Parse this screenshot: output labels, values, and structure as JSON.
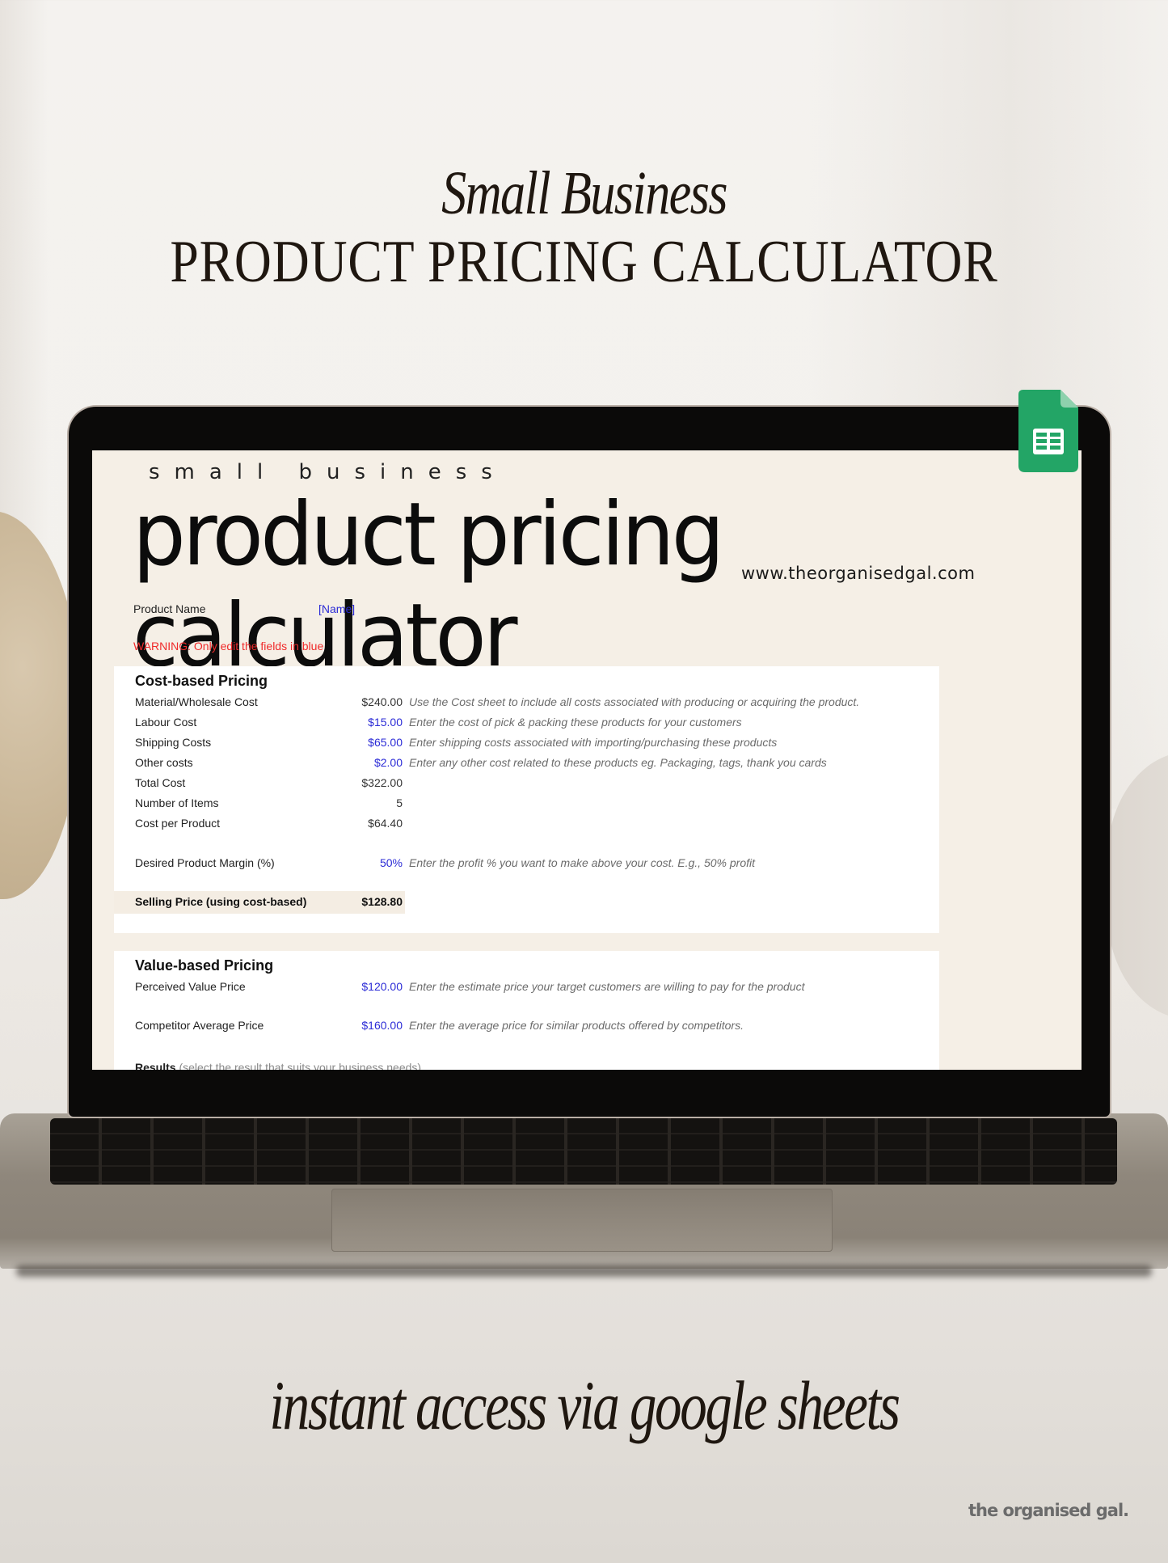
{
  "promo": {
    "headline_sub": "Small Business",
    "headline_main": "PRODUCT PRICING CALCULATOR",
    "tagline": "instant access via google sheets",
    "brand_logo": "the organised gal."
  },
  "app": {
    "icon": "google-sheets-icon",
    "colors": {
      "sheets_green": "#23a566",
      "sheets_fold": "#8ed1ad",
      "input_blue": "#2b2bd6",
      "warning_red": "#f02a2a",
      "sheet_bg": "#f5efe6",
      "card_bg": "#ffffff",
      "highlight_bg": "#f4ede3"
    }
  },
  "sheet": {
    "kicker": "small business",
    "title": "product pricing calculator",
    "url": "www.theorganisedgal.com",
    "product_name_label": "Product Name",
    "product_name_value": "[Name]",
    "warning": "WARNING: Only edit the fields in blue",
    "cost_based": {
      "title": "Cost-based Pricing",
      "rows": [
        {
          "label": "Material/Wholesale Cost",
          "value": "$240.00",
          "desc": "Use the Cost sheet to include all costs associated with producing or acquiring the product.",
          "editable": false
        },
        {
          "label": "Labour Cost",
          "value": "$15.00",
          "desc": "Enter the cost of pick & packing these products for your customers",
          "editable": true
        },
        {
          "label": "Shipping Costs",
          "value": "$65.00",
          "desc": "Enter shipping costs associated with importing/purchasing these products",
          "editable": true
        },
        {
          "label": "Other costs",
          "value": "$2.00",
          "desc": "Enter any other cost related to these products eg. Packaging, tags, thank you cards",
          "editable": true
        },
        {
          "label": "Total Cost",
          "value": "$322.00",
          "desc": "",
          "editable": false
        },
        {
          "label": "Number of Items",
          "value": "5",
          "desc": "",
          "editable": false
        },
        {
          "label": "Cost per Product",
          "value": "$64.40",
          "desc": "",
          "editable": false
        }
      ],
      "margin": {
        "label": "Desired Product Margin (%)",
        "value": "50%",
        "desc": "Enter the profit % you want to make above your cost. E.g., 50% profit"
      },
      "selling_price": {
        "label": "Selling Price (using cost-based)",
        "value": "$128.80"
      }
    },
    "value_based": {
      "title": "Value-based Pricing",
      "rows": [
        {
          "label": "Perceived Value Price",
          "value": "$120.00",
          "desc": "Enter the estimate price your target customers are willing to pay for the product"
        },
        {
          "label": "Competitor Average Price",
          "value": "$160.00",
          "desc": "Enter the average price for similar products offered by competitors."
        }
      ],
      "results_label": "Results",
      "results_hint": "(select the result that suits your business needs)"
    }
  }
}
